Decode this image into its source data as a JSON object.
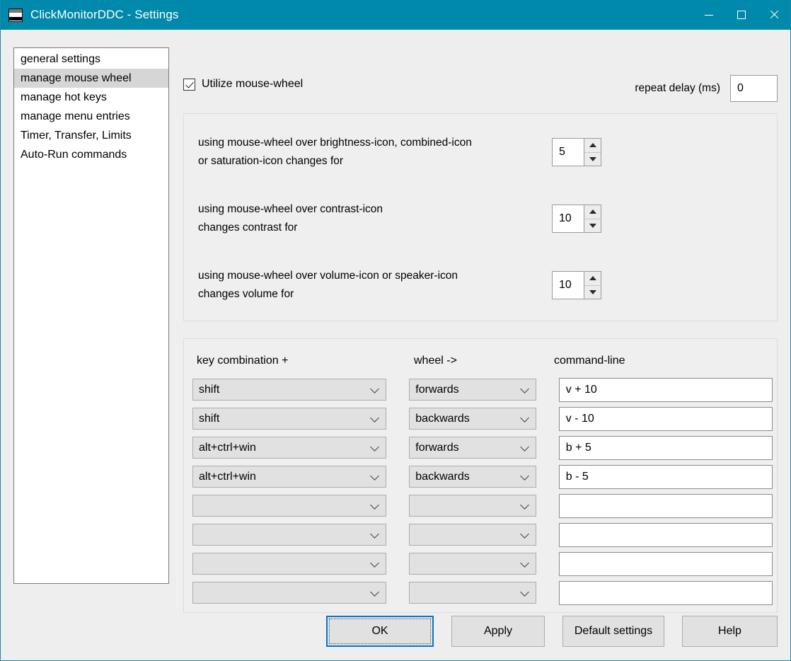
{
  "window": {
    "title": "ClickMonitorDDC - Settings",
    "icon": "monitor-bands-icon",
    "accent_color": "#0089ab",
    "controls": {
      "minimize": "minimize-icon",
      "maximize": "maximize-icon",
      "close": "close-icon"
    }
  },
  "sidebar": {
    "items": [
      {
        "label": "general settings",
        "selected": false
      },
      {
        "label": "manage mouse wheel",
        "selected": true
      },
      {
        "label": "manage hot keys",
        "selected": false
      },
      {
        "label": "manage menu entries",
        "selected": false
      },
      {
        "label": "Timer, Transfer, Limits",
        "selected": false
      },
      {
        "label": "Auto-Run commands",
        "selected": false
      }
    ]
  },
  "main": {
    "utilize": {
      "label": "Utilize mouse-wheel",
      "checked": true
    },
    "repeat_delay": {
      "label": "repeat delay (ms)",
      "value": "0"
    },
    "wheel_settings": [
      {
        "line1": "using mouse-wheel over brightness-icon, combined-icon",
        "line2": "or saturation-icon changes for",
        "value": "5"
      },
      {
        "line1": "using mouse-wheel over contrast-icon",
        "line2": "changes contrast for",
        "value": "10"
      },
      {
        "line1": "using mouse-wheel over volume-icon or speaker-icon",
        "line2": "changes volume for",
        "value": "10"
      }
    ],
    "combos": {
      "headers": {
        "key": "key combination  +",
        "wheel": "wheel  ->",
        "command": "command-line"
      },
      "rows": [
        {
          "key": "shift",
          "wheel": "forwards",
          "command": "v + 10"
        },
        {
          "key": "shift",
          "wheel": "backwards",
          "command": "v - 10"
        },
        {
          "key": "alt+ctrl+win",
          "wheel": "forwards",
          "command": "b + 5"
        },
        {
          "key": "alt+ctrl+win",
          "wheel": "backwards",
          "command": "b - 5"
        },
        {
          "key": "",
          "wheel": "",
          "command": ""
        },
        {
          "key": "",
          "wheel": "",
          "command": ""
        },
        {
          "key": "",
          "wheel": "",
          "command": ""
        },
        {
          "key": "",
          "wheel": "",
          "command": ""
        }
      ]
    }
  },
  "footer": {
    "ok": "OK",
    "apply": "Apply",
    "default_settings": "Default settings",
    "help": "Help"
  }
}
